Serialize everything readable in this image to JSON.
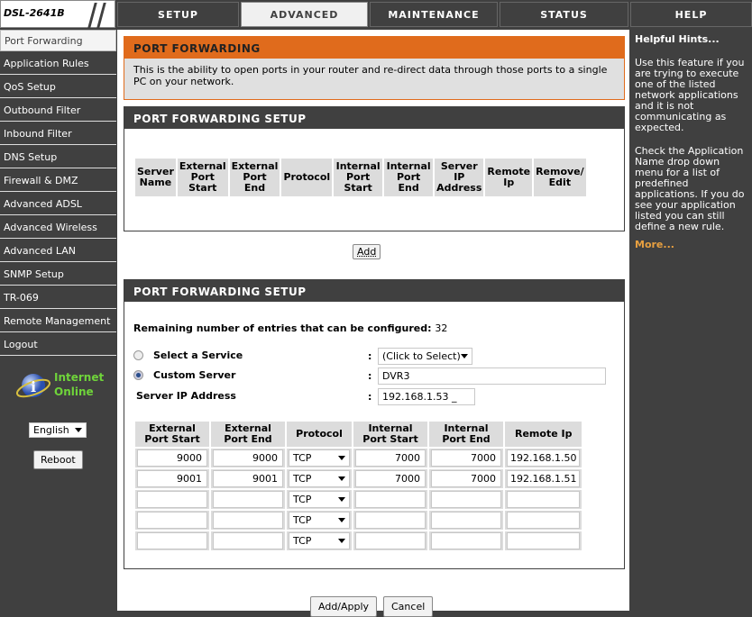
{
  "logo": "DSL-2641B",
  "nav": {
    "tabs": [
      "SETUP",
      "ADVANCED",
      "MAINTENANCE",
      "STATUS",
      "HELP"
    ],
    "active": "ADVANCED"
  },
  "sidebar": {
    "items": [
      "Port Forwarding",
      "Application Rules",
      "QoS Setup",
      "Outbound Filter",
      "Inbound Filter",
      "DNS Setup",
      "Firewall & DMZ",
      "Advanced ADSL",
      "Advanced Wireless",
      "Advanced LAN",
      "SNMP Setup",
      "TR-069",
      "Remote Management",
      "Logout"
    ],
    "status": "Internet\nOnline",
    "status_line1": "Internet",
    "status_line2": "Online",
    "language": "English",
    "reboot": "Reboot"
  },
  "intro": {
    "title": "PORT FORWARDING",
    "text": "This is the ability to open ports in your router and re-direct data through those ports to a single PC on your network."
  },
  "rules": {
    "title": "PORT FORWARDING SETUP",
    "headers": [
      "Server Name",
      "External Port Start",
      "External Port End",
      "Protocol",
      "Internal Port Start",
      "Internal Port End",
      "Server IP Address",
      "Remote Ip",
      "Remove/ Edit"
    ],
    "add": "Add"
  },
  "setup": {
    "title": "PORT FORWARDING SETUP",
    "remaining_label": "Remaining number of entries that can be configured:",
    "remaining": "32",
    "select_service": "Select a Service",
    "service_value": "(Click to Select)",
    "custom_server": "Custom Server",
    "custom_value": "DVR3",
    "ip_label": "Server IP Address",
    "ip_value": "192.168.1.53 _",
    "colon": ":",
    "headers": [
      "External Port Start",
      "External Port End",
      "Protocol",
      "Internal Port Start",
      "Internal Port End",
      "Remote Ip"
    ],
    "rows": [
      [
        "9000",
        "9000",
        "TCP",
        "7000",
        "7000",
        "192.168.1.50"
      ],
      [
        "9001",
        "9001",
        "TCP",
        "7000",
        "7000",
        "192.168.1.51"
      ],
      [
        "",
        "",
        "TCP",
        "",
        "",
        ""
      ],
      [
        "",
        "",
        "TCP",
        "",
        "",
        ""
      ],
      [
        "",
        "",
        "TCP",
        "",
        "",
        ""
      ]
    ],
    "apply": "Add/Apply",
    "cancel": "Cancel"
  },
  "help": {
    "title": "Helpful Hints...",
    "p1": "Use this feature if you are trying to execute one of the listed network applications and it is not communicating as expected.",
    "p2": "Check the Application Name drop down menu for a list of predefined applications. If you do see your application listed you can still define a new rule.",
    "more": "More..."
  }
}
